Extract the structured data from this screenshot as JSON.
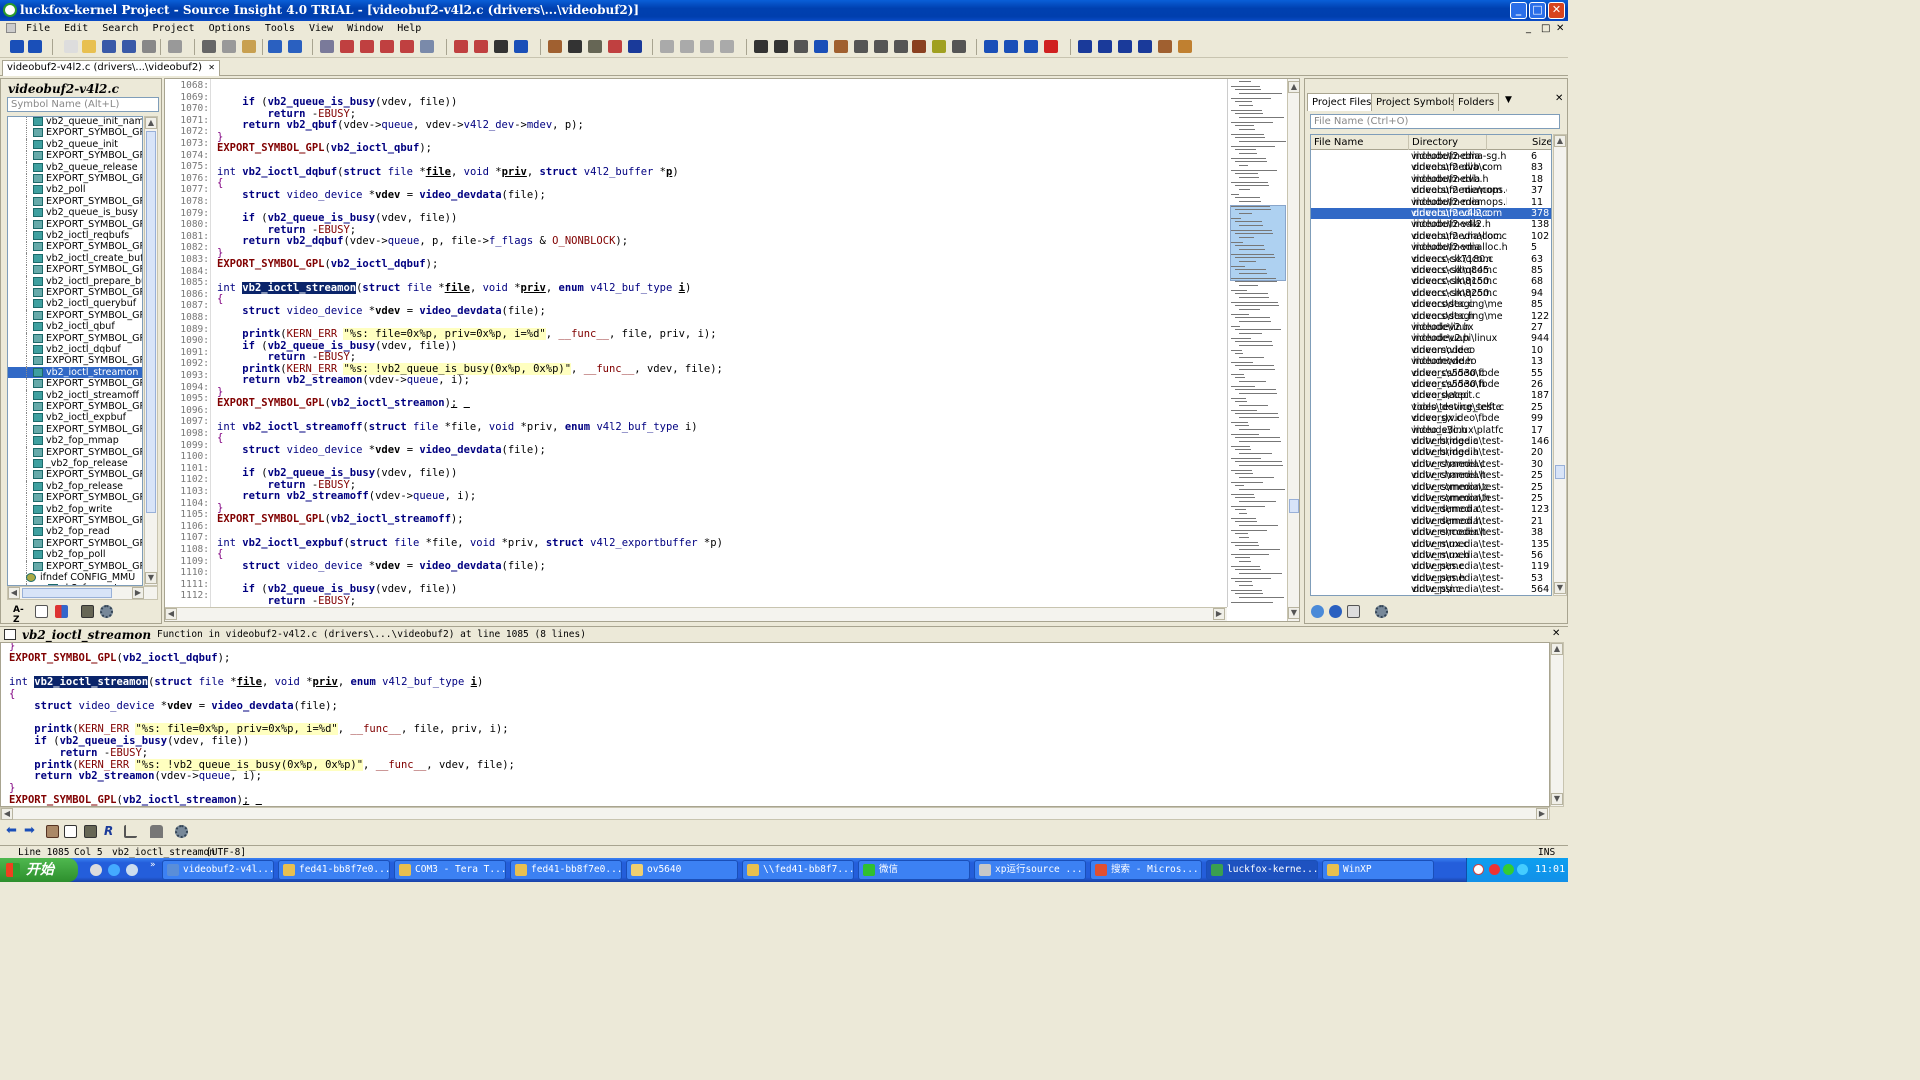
{
  "window": {
    "title": "luckfox-kernel Project - Source Insight 4.0 TRIAL - [videobuf2-v4l2.c (drivers\\...\\videobuf2)]",
    "min": "_",
    "max": "□",
    "close": "✕"
  },
  "menu": [
    "File",
    "Edit",
    "Search",
    "Project",
    "Options",
    "Tools",
    "View",
    "Window",
    "Help"
  ],
  "doc_tab": {
    "label": "videobuf2-v4l2.c (drivers\\...\\videobuf2)",
    "close": "✕"
  },
  "symbol_panel": {
    "title": "videobuf2-v4l2.c",
    "search_placeholder": "Symbol Name (Alt+L)",
    "items": [
      "vb2_queue_init_name",
      "EXPORT_SYMBOL_GPL",
      "vb2_queue_init",
      "EXPORT_SYMBOL_GPL",
      "vb2_queue_release",
      "EXPORT_SYMBOL_GPL",
      "vb2_poll",
      "EXPORT_SYMBOL_GPL",
      "vb2_queue_is_busy",
      "EXPORT_SYMBOL_GPL",
      "vb2_ioctl_reqbufs",
      "EXPORT_SYMBOL_GPL",
      "vb2_ioctl_create_bufs",
      "EXPORT_SYMBOL_GPL",
      "vb2_ioctl_prepare_buf",
      "EXPORT_SYMBOL_GPL",
      "vb2_ioctl_querybuf",
      "EXPORT_SYMBOL_GPL",
      "vb2_ioctl_qbuf",
      "EXPORT_SYMBOL_GPL",
      "vb2_ioctl_dqbuf",
      "EXPORT_SYMBOL_GPL",
      "vb2_ioctl_streamon",
      "EXPORT_SYMBOL_GPL",
      "vb2_ioctl_streamoff",
      "EXPORT_SYMBOL_GPL",
      "vb2_ioctl_expbuf",
      "EXPORT_SYMBOL_GPL",
      "vb2_fop_mmap",
      "EXPORT_SYMBOL_GPL",
      "_vb2_fop_release",
      "EXPORT_SYMBOL_GPL",
      "vb2_fop_release",
      "EXPORT_SYMBOL_GPL",
      "vb2_fop_write",
      "EXPORT_SYMBOL_GPL",
      "vb2_fop_read",
      "EXPORT_SYMBOL_GPL",
      "vb2_fop_poll",
      "EXPORT_SYMBOL_GPL",
      "ifndef CONFIG_MMU",
      "vb2_fop_get_unmapp"
    ],
    "selected_index": 22
  },
  "editor": {
    "line_numbers": [
      "1068:",
      "1069:",
      "1070:",
      "1071:",
      "1072:",
      "1073:",
      "1074:",
      "1075:",
      "1076:",
      "1077:",
      "1078:",
      "1079:",
      "1080:",
      "1081:",
      "1082:",
      "1083:",
      "1084:",
      "1085:",
      "1086:",
      "1087:",
      "1088:",
      "1089:",
      "1090:",
      "1091:",
      "1092:",
      "1093:",
      "1094:",
      "1095:",
      "1096:",
      "1097:",
      "1098:",
      "1099:",
      "1100:",
      "1101:",
      "1102:",
      "1103:",
      "1104:",
      "1105:",
      "1106:",
      "1107:",
      "1108:",
      "1109:",
      "1110:",
      "1111:",
      "1112:"
    ]
  },
  "project_panel": {
    "tabs": [
      "Project Files",
      "Project Symbols",
      "Folders"
    ],
    "tab_close": "✕",
    "search_placeholder": "File Name (Ctrl+O)",
    "columns": [
      "File Name",
      "Directory",
      "Size"
    ],
    "files": [
      [
        "videobuf2-dma-sg.h",
        "include\\media",
        "6"
      ],
      [
        "videobuf2-dvb.c",
        "drivers\\media\\com",
        "83"
      ],
      [
        "videobuf2-dvb.h",
        "include\\media",
        "18"
      ],
      [
        "videobuf2-memops.c",
        "drivers\\media\\com",
        "37"
      ],
      [
        "videobuf2-memops.h",
        "include\\media",
        "11"
      ],
      [
        "videobuf2-v4l2.c",
        "drivers\\media\\com",
        "378"
      ],
      [
        "videobuf2-v4l2.h",
        "include\\media",
        "138"
      ],
      [
        "videobuf2-vmalloc.c",
        "drivers\\media\\com",
        "102"
      ],
      [
        "videobuf2-vmalloc.h",
        "include\\media",
        "5"
      ],
      [
        "videocc-sc7180.c",
        "drivers\\clk\\qcom",
        "63"
      ],
      [
        "videocc-sdm845.c",
        "drivers\\clk\\qcom",
        "85"
      ],
      [
        "videocc-sm8150.c",
        "drivers\\clk\\qcom",
        "68"
      ],
      [
        "videocc-sm8250.c",
        "drivers\\clk\\qcom",
        "94"
      ],
      [
        "videocodec.c",
        "drivers\\staging\\me",
        "85"
      ],
      [
        "videocodec.h",
        "drivers\\staging\\me",
        "122"
      ],
      [
        "videodev2.h",
        "include\\linux",
        "27"
      ],
      [
        "videodev2.h",
        "include\\uapi\\linux",
        "944"
      ],
      [
        "videomode.c",
        "drivers\\video",
        "10"
      ],
      [
        "videomode.h",
        "include\\video",
        "13"
      ],
      [
        "video_cs5530.c",
        "drivers\\video\\fbde",
        "55"
      ],
      [
        "video_cs5530.h",
        "drivers\\video\\fbde",
        "26"
      ],
      [
        "video_detect.c",
        "drivers\\acpi",
        "187"
      ],
      [
        "video_device_test.c",
        "tools\\testing\\selfte",
        "25"
      ],
      [
        "video_gx.c",
        "drivers\\video\\fbde",
        "99"
      ],
      [
        "video_s3c.h",
        "include\\linux\\platfc",
        "17"
      ],
      [
        "vidtv_bridge.c",
        "drivers\\media\\test-",
        "146"
      ],
      [
        "vidtv_bridge.h",
        "drivers\\media\\test-",
        "20"
      ],
      [
        "vidtv_channel.c",
        "drivers\\media\\test-",
        "30"
      ],
      [
        "vidtv_channel.h",
        "drivers\\media\\test-",
        "25"
      ],
      [
        "vidtv_common.c",
        "drivers\\media\\test-",
        "25"
      ],
      [
        "vidtv_common.h",
        "drivers\\media\\test-",
        "25"
      ],
      [
        "vidtv_demod.c",
        "drivers\\media\\test-",
        "123"
      ],
      [
        "vidtv_demod.h",
        "drivers\\media\\test-",
        "21"
      ],
      [
        "vidtv_encoder.h",
        "drivers\\media\\test-",
        "38"
      ],
      [
        "vidtv_mux.c",
        "drivers\\media\\test-",
        "135"
      ],
      [
        "vidtv_mux.h",
        "drivers\\media\\test-",
        "56"
      ],
      [
        "vidtv_pes.c",
        "drivers\\media\\test-",
        "119"
      ],
      [
        "vidtv_pes.h",
        "drivers\\media\\test-",
        "53"
      ],
      [
        "vidtv_psi.c",
        "drivers\\media\\test-",
        "564"
      ]
    ],
    "selected_index": 5
  },
  "context": {
    "symbol": "vb2_ioctl_streamon",
    "info": "Function in videobuf2-v4l2.c (drivers\\...\\videobuf2) at line 1085 (8 lines)",
    "close": "✕"
  },
  "status": {
    "line": "Line 1085",
    "col": "Col 5",
    "symbol": "vb2_ioctl_streamon",
    "encoding": "[UTF-8]",
    "mode": "INS"
  },
  "taskbar": {
    "start": "开始",
    "tasks": [
      {
        "label": "videobuf2-v4l...",
        "color": "#5a8ed8"
      },
      {
        "label": "fed41-bb8f7e0...",
        "color": "#e8c050"
      },
      {
        "label": "COM3 - Tera T...",
        "color": "#e8c050"
      },
      {
        "label": "fed41-bb8f7e0...",
        "color": "#e8c050"
      },
      {
        "label": "ov5640",
        "color": "#f0d070"
      },
      {
        "label": "\\\\fed41-bb8f7...",
        "color": "#e8c050"
      },
      {
        "label": "微信",
        "color": "#30c030"
      },
      {
        "label": "xp运行source ...",
        "color": "#c8c8c8"
      },
      {
        "label": "搜索 - Micros...",
        "color": "#e05030"
      },
      {
        "label": "luckfox-kerne...",
        "color": "#3aa050"
      },
      {
        "label": "WinXP",
        "color": "#e8c050"
      }
    ],
    "active_index": 9,
    "clock": "11:01"
  }
}
